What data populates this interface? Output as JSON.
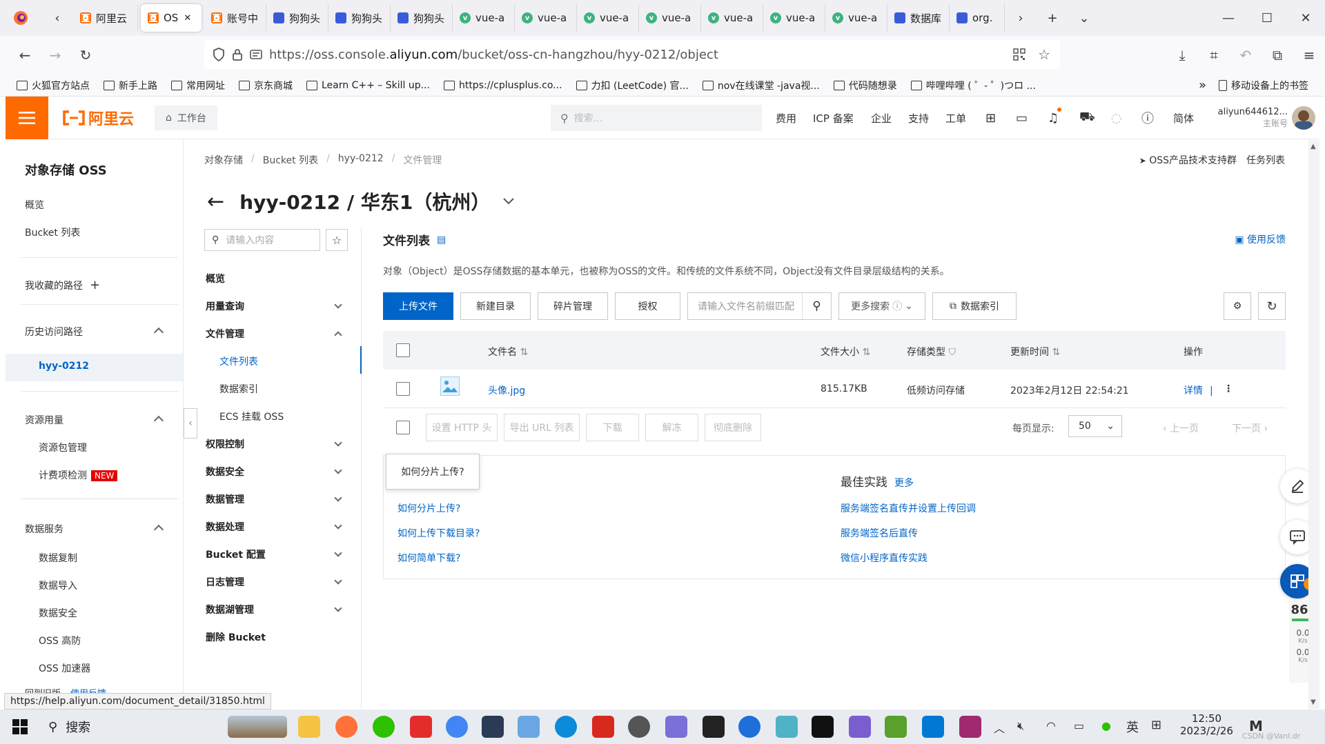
{
  "browser": {
    "tabs": [
      {
        "label": "阿里云",
        "icon": "aliyun-favicon"
      },
      {
        "label": "OS",
        "icon": "aliyun-favicon",
        "active": true
      },
      {
        "label": "账号中",
        "icon": "aliyun-favicon"
      },
      {
        "label": "狗狗头",
        "icon": "paw-favicon"
      },
      {
        "label": "狗狗头",
        "icon": "paw-favicon"
      },
      {
        "label": "狗狗头",
        "icon": "paw-favicon"
      },
      {
        "label": "vue-a",
        "icon": "vue-favicon"
      },
      {
        "label": "vue-a",
        "icon": "vue-favicon"
      },
      {
        "label": "vue-a",
        "icon": "vue-favicon"
      },
      {
        "label": "vue-a",
        "icon": "vue-favicon"
      },
      {
        "label": "vue-a",
        "icon": "vue-favicon"
      },
      {
        "label": "vue-a",
        "icon": "vue-favicon"
      },
      {
        "label": "vue-a",
        "icon": "vue-favicon"
      },
      {
        "label": "数据库",
        "icon": "paw-favicon"
      },
      {
        "label": "org.",
        "icon": "globe-favicon"
      }
    ],
    "url_prefix": "https://oss.console.",
    "url_host": "aliyun.com",
    "url_path": "/bucket/oss-cn-hangzhou/hyy-0212/object",
    "bookmarks": [
      "火狐官方站点",
      "新手上路",
      "常用网址",
      "京东商城",
      "Learn C++ – Skill up...",
      "https://cplusplus.co...",
      "力扣 (LeetCode) 官...",
      "nov在线课堂 -java视...",
      "代码随想录",
      "哔哩哔哩 ( ゜- ゜)つロ ..."
    ],
    "mobile_bookmarks": "移动设备上的书签",
    "status_url": "https://help.aliyun.com/document_detail/31850.html"
  },
  "header": {
    "logo": "阿里云",
    "workbench": "工作台",
    "search_placeholder": "搜索...",
    "menus": [
      "费用",
      "ICP 备案",
      "企业",
      "支持",
      "工单"
    ],
    "lang": "简体",
    "account": "aliyun644612...",
    "account_type": "主账号"
  },
  "sidebar": {
    "title": "对象存储 OSS",
    "overview": "概览",
    "bucket_list": "Bucket 列表",
    "fav_paths": "我收藏的路径",
    "history": "历史访问路径",
    "history_item": "hyy-0212",
    "resource": "资源用量",
    "resource_pkg": "资源包管理",
    "billing_check": "计费项检测",
    "new_badge": "NEW",
    "data_service": "数据服务",
    "data_copy": "数据复制",
    "data_import": "数据导入",
    "data_security": "数据安全",
    "oss_hf": "OSS 高防",
    "oss_accel": "OSS 加速器",
    "return_old": "回到旧版",
    "use_feedback": "使用反馈"
  },
  "breadcrumb": [
    "对象存储",
    "Bucket 列表",
    "hyy-0212",
    "文件管理"
  ],
  "top_right": {
    "support_group": "OSS产品技术支持群",
    "task_list": "任务列表"
  },
  "page_title": "hyy-0212 / 华东1（杭州）",
  "subnav": {
    "search_placeholder": "请输入内容",
    "overview": "概览",
    "usage_query": "用量查询",
    "file_mgmt": "文件管理",
    "file_list": "文件列表",
    "data_index": "数据索引",
    "ecs_mount": "ECS 挂载 OSS",
    "access_ctrl": "权限控制",
    "data_security": "数据安全",
    "data_mgmt": "数据管理",
    "data_proc": "数据处理",
    "bucket_config": "Bucket 配置",
    "log_mgmt": "日志管理",
    "datalake_mgmt": "数据湖管理",
    "delete_bucket": "删除 Bucket"
  },
  "content": {
    "title": "文件列表",
    "feedback": "使用反馈",
    "description": "对象（Object）是OSS存储数据的基本单元，也被称为OSS的文件。和传统的文件系统不同，Object没有文件目录层级结构的关系。",
    "toolbar": {
      "upload": "上传文件",
      "new_dir": "新建目录",
      "fragments": "碎片管理",
      "authorize": "授权",
      "search_placeholder": "请输入文件名前缀匹配",
      "more_search": "更多搜索",
      "data_index": "数据索引"
    },
    "table": {
      "columns": [
        "文件名",
        "文件大小",
        "存储类型",
        "更新时间",
        "操作"
      ],
      "rows": [
        {
          "name": "头像.jpg",
          "size": "815.17KB",
          "storage": "低频访问存储",
          "updated": "2023年2月12日 22:54:21",
          "action": "详情"
        }
      ]
    },
    "bulk": {
      "set_http": "设置 HTTP 头",
      "export_url": "导出 URL 列表",
      "download": "下载",
      "unfreeze": "解冻",
      "delete": "彻底删除",
      "per_page_label": "每页显示:",
      "per_page": "50",
      "prev": "上一页",
      "next": "下一页"
    },
    "help": {
      "tooltip": "如何分片上传?",
      "links_left": [
        "如何分片上传?",
        "如何上传下载目录?",
        "如何简单下载?"
      ],
      "best_practice": "最佳实践",
      "more": "更多",
      "links_right": [
        "服务端签名直传并设置上传回调",
        "服务端签名后直传",
        "微信小程序直传实践"
      ]
    }
  },
  "widget": {
    "percent": "86",
    "pct_sign": "%",
    "up": "0.0",
    "down": "0.0",
    "unit": "K/s",
    "badge": "1"
  },
  "taskbar": {
    "search": "搜索",
    "time": "12:50",
    "date": "2023/2/26",
    "ime": "英",
    "watermark": "CSDN @Vanl.dr"
  },
  "colors": {
    "accent": "#ff6a00",
    "primary": "#0064c8"
  }
}
